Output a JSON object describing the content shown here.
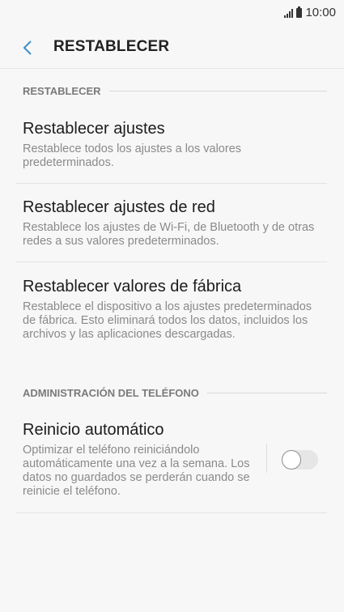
{
  "status_bar": {
    "time": "10:00"
  },
  "header": {
    "title": "RESTABLECER"
  },
  "sections": [
    {
      "label": "RESTABLECER"
    },
    {
      "label": "ADMINISTRACIÓN DEL TELÉFONO"
    }
  ],
  "items": [
    {
      "title": "Restablecer ajustes",
      "description": "Restablece todos los ajustes a los valores predeterminados."
    },
    {
      "title": "Restablecer ajustes de red",
      "description": "Restablece los ajustes de Wi-Fi, de Bluetooth y de otras redes a sus valores predeterminados."
    },
    {
      "title": "Restablecer valores de fábrica",
      "description": "Restablece el dispositivo a los ajustes predeterminados de fábrica. Esto eliminará todos los datos, incluidos los archivos y las aplicaciones descargadas."
    },
    {
      "title": "Reinicio automático",
      "description": "Optimizar el teléfono reiniciándolo automáticamente una vez a la semana. Los datos no guardados se perderán cuando se reinicie el teléfono.",
      "toggle_on": false
    }
  ]
}
